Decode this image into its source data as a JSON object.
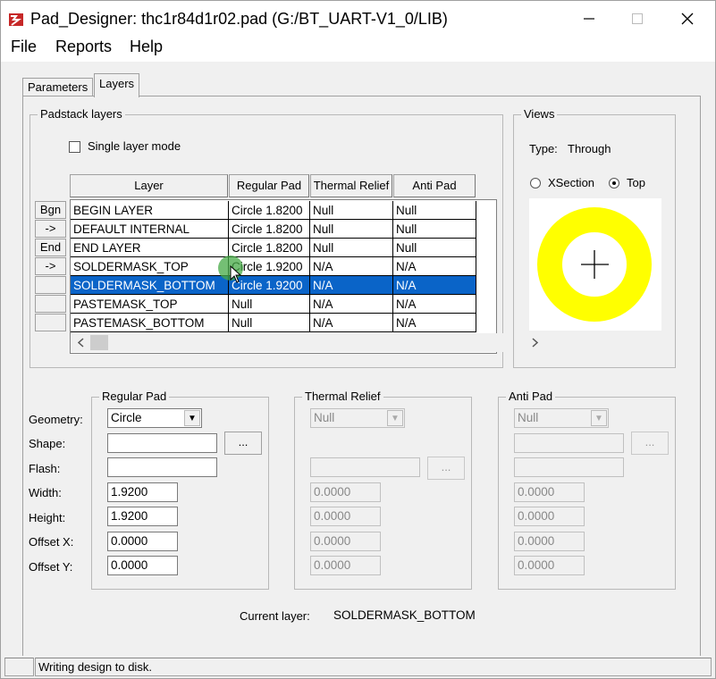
{
  "window": {
    "title": "Pad_Designer: thc1r84d1r02.pad (G:/BT_UART-V1_0/LIB)",
    "minimize_icon": "minimize-icon",
    "maximize_icon": "maximize-icon",
    "close_icon": "close-icon"
  },
  "menu": [
    "File",
    "Reports",
    "Help"
  ],
  "tabs": [
    {
      "label": "Parameters",
      "active": false
    },
    {
      "label": "Layers",
      "active": true
    }
  ],
  "padstack": {
    "group_label": "Padstack layers",
    "single_layer_label": "Single layer mode",
    "single_layer_checked": false,
    "columns": [
      "Layer",
      "Regular Pad",
      "Thermal Relief",
      "Anti Pad"
    ],
    "row_buttons": [
      "Bgn",
      "->",
      "End",
      "->",
      "",
      "",
      ""
    ],
    "rows": [
      {
        "layer": "BEGIN LAYER",
        "regular": "Circle 1.8200",
        "thermal": "Null",
        "anti": "Null",
        "selected": false
      },
      {
        "layer": "DEFAULT INTERNAL",
        "regular": "Circle 1.8200",
        "thermal": "Null",
        "anti": "Null",
        "selected": false
      },
      {
        "layer": "END LAYER",
        "regular": "Circle 1.8200",
        "thermal": "Null",
        "anti": "Null",
        "selected": false
      },
      {
        "layer": "SOLDERMASK_TOP",
        "regular": "Circle 1.9200",
        "thermal": "N/A",
        "anti": "N/A",
        "selected": false
      },
      {
        "layer": "SOLDERMASK_BOTTOM",
        "regular": "Circle 1.9200",
        "thermal": "N/A",
        "anti": "N/A",
        "selected": true
      },
      {
        "layer": "PASTEMASK_TOP",
        "regular": "Null",
        "thermal": "N/A",
        "anti": "N/A",
        "selected": false
      },
      {
        "layer": "PASTEMASK_BOTTOM",
        "regular": "Null",
        "thermal": "N/A",
        "anti": "N/A",
        "selected": false
      }
    ]
  },
  "views": {
    "group_label": "Views",
    "type_label": "Type:",
    "type_value": "Through",
    "xsection_label": "XSection",
    "top_label": "Top",
    "selected_view": "Top",
    "pad_color": "#ffff00"
  },
  "regular_pad": {
    "group_label": "Regular Pad",
    "geometry": "Circle",
    "shape": "",
    "flash": "",
    "width": "1.9200",
    "height": "1.9200",
    "offset_x": "0.0000",
    "offset_y": "0.0000",
    "browse_label": "..."
  },
  "thermal_relief": {
    "group_label": "Thermal Relief",
    "geometry": "Null",
    "flash": "",
    "width": "0.0000",
    "height": "0.0000",
    "offset_x": "0.0000",
    "offset_y": "0.0000",
    "browse_label": "..."
  },
  "anti_pad": {
    "group_label": "Anti Pad",
    "geometry": "Null",
    "shape": "",
    "flash": "",
    "width": "0.0000",
    "height": "0.0000",
    "offset_x": "0.0000",
    "offset_y": "0.0000",
    "browse_label": "..."
  },
  "field_labels": [
    "Geometry:",
    "Shape:",
    "Flash:",
    "Width:",
    "Height:",
    "Offset X:",
    "Offset Y:"
  ],
  "current_layer": {
    "label": "Current layer:",
    "value": "SOLDERMASK_BOTTOM"
  },
  "status": {
    "message": "Writing design to disk."
  },
  "accent_color": "#0a64c8"
}
